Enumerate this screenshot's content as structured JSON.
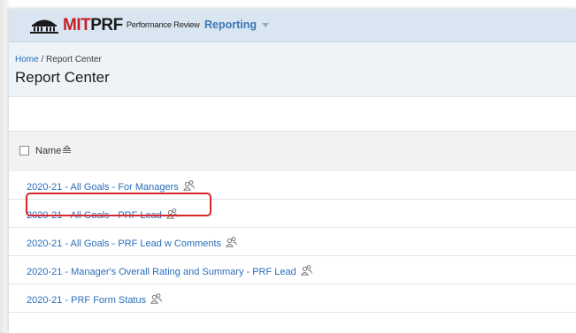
{
  "app": {
    "logo_mit": "MIT",
    "logo_prf": "PRF",
    "logo_sub": "Performance Review",
    "nav_reporting": "Reporting"
  },
  "breadcrumb": {
    "home": "Home",
    "separator": " / ",
    "current": "Report Center"
  },
  "page": {
    "title": "Report Center"
  },
  "table": {
    "column_name": "Name",
    "rows": [
      {
        "label": "2020-21 - All Goals - For Managers"
      },
      {
        "label": "2020-21 - All Goals - PRF Lead"
      },
      {
        "label": "2020-21 - All Goals - PRF Lead w Comments"
      },
      {
        "label": "2020-21 - Manager's Overall Rating and Summary - PRF Lead"
      },
      {
        "label": "2020-21 - PRF Form Status"
      }
    ]
  },
  "colors": {
    "topbar": "#d9e6f2",
    "link": "#2a6ebb",
    "logo_red": "#c62127",
    "highlight": "#d7262e"
  },
  "icons": {
    "logo": "dome-building-icon",
    "row": "shared-users-icon",
    "sort": "sort-icon",
    "dropdown": "caret-down-icon"
  }
}
